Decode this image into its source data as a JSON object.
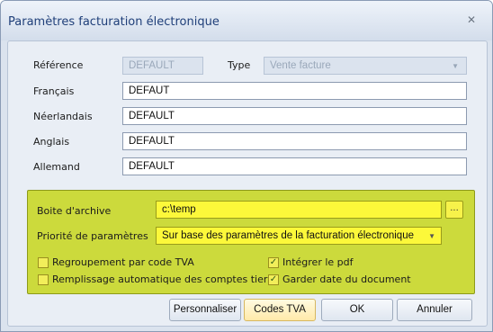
{
  "window": {
    "title": "Paramètres facturation électronique",
    "close_icon": "close-icon"
  },
  "form": {
    "reference_label": "Référence",
    "reference_value": "DEFAULT",
    "type_label": "Type",
    "type_value": "Vente facture",
    "francais_label": "Français",
    "francais_value": "DEFAUT",
    "neerlandais_label": "Néerlandais",
    "neerlandais_value": "DEFAULT",
    "anglais_label": "Anglais",
    "anglais_value": "DEFAULT",
    "allemand_label": "Allemand",
    "allemand_value": "DEFAULT"
  },
  "archive": {
    "boite_label": "Boite d'archive",
    "boite_value": "c:\\temp",
    "ellipsis_label": "...",
    "priorite_label": "Priorité de paramètres",
    "priorite_value": "Sur base des paramètres de la facturation électronique",
    "checkboxes": [
      {
        "label": "Regroupement par code TVA",
        "checked": false
      },
      {
        "label": "Intégrer le pdf",
        "checked": true
      },
      {
        "label": "Remplissage automatique des comptes tiers",
        "checked": false
      },
      {
        "label": "Garder date du document",
        "checked": true
      }
    ]
  },
  "buttons": {
    "personnaliser": "Personnaliser",
    "codes_tva": "Codes TVA",
    "ok": "OK",
    "annuler": "Annuler"
  },
  "colors": {
    "archive_box": "#ccda3c",
    "yellow_field": "#fcf83a",
    "title_text": "#1f3f79"
  }
}
